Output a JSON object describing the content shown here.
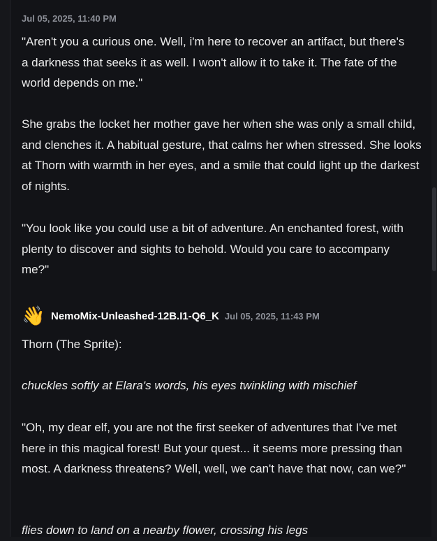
{
  "message1": {
    "timestamp": "Jul 05, 2025, 11:40 PM",
    "paragraphs": [
      "\"Aren't you a curious one. Well, i'm here to recover an artifact, but there's a darkness that seeks it as well. I won't allow it to take it. The fate of the world depends on me.\"",
      "She grabs the locket her mother gave her when she was only a small child, and clenches it. A habitual gesture, that calms her when stressed. She looks at Thorn with warmth in her eyes, and a smile that could light up the darkest of nights.",
      "\"You look like you could use a bit of adventure. An enchanted forest, with plenty to discover and sights to behold. Would you care to accompany me?\""
    ]
  },
  "message2": {
    "avatar": "👋",
    "avatar_icon": "waving-hand-icon",
    "author": "NemoMix-Unleashed-12B.I1-Q6_K",
    "timestamp": "Jul 05, 2025, 11:43 PM",
    "paragraphs": [
      "Thorn (The Sprite):",
      "chuckles softly at Elara's words, his eyes twinkling with mischief",
      "\"Oh, my dear elf, you are not the first seeker of adventures that I've met here in this magical forest! But your quest... it seems more pressing than most. A darkness threatens? Well, well, we can't have that now, can we?\"",
      "flies down to land on a nearby flower, crossing his legs"
    ]
  }
}
